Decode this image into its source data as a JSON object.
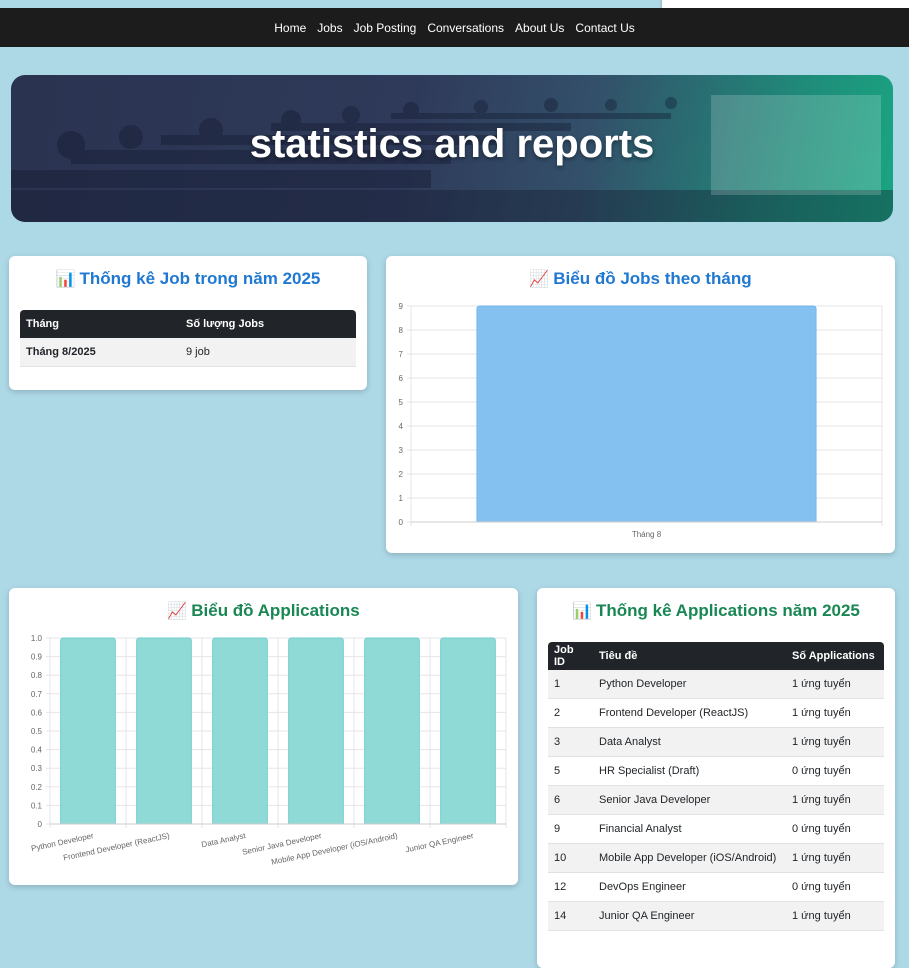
{
  "nav": {
    "items": [
      "Home",
      "Jobs",
      "Job Posting",
      "Conversations",
      "About Us",
      "Contact Us"
    ]
  },
  "hero": {
    "title": "statistics and reports"
  },
  "job_stats": {
    "icon": "bar-chart-emoji",
    "title": "Thống kê Job trong năm 2025",
    "headers": [
      "Tháng",
      "Số lượng Jobs"
    ],
    "rows": [
      {
        "month": "Tháng 8/2025",
        "count": "9 job"
      }
    ]
  },
  "jobs_chart": {
    "icon": "chart-increasing-emoji",
    "title": "Biểu đồ Jobs theo tháng"
  },
  "apps_chart": {
    "icon": "chart-increasing-emoji",
    "title": "Biểu đồ Applications"
  },
  "app_stats": {
    "icon": "bar-chart-emoji",
    "title": "Thống kê Applications năm 2025",
    "headers": [
      "Job ID",
      "Tiêu đề",
      "Số Applications"
    ],
    "rows": [
      {
        "id": "1",
        "title": "Python Developer",
        "apps": "1 ứng tuyển"
      },
      {
        "id": "2",
        "title": "Frontend Developer (ReactJS)",
        "apps": "1 ứng tuyển"
      },
      {
        "id": "3",
        "title": "Data Analyst",
        "apps": "1 ứng tuyển"
      },
      {
        "id": "5",
        "title": "HR Specialist (Draft)",
        "apps": "0 ứng tuyển"
      },
      {
        "id": "6",
        "title": "Senior Java Developer",
        "apps": "1 ứng tuyển"
      },
      {
        "id": "9",
        "title": "Financial Analyst",
        "apps": "0 ứng tuyển"
      },
      {
        "id": "10",
        "title": "Mobile App Developer (iOS/Android)",
        "apps": "1 ứng tuyển"
      },
      {
        "id": "12",
        "title": "DevOps Engineer",
        "apps": "0 ứng tuyển"
      },
      {
        "id": "14",
        "title": "Junior QA Engineer",
        "apps": "1 ứng tuyển"
      }
    ]
  },
  "chart_data": [
    {
      "type": "bar",
      "categories": [
        "Tháng 8"
      ],
      "values": [
        9
      ],
      "ylim": [
        0,
        9
      ],
      "yticks": [
        "0",
        "1",
        "2",
        "3",
        "4",
        "5",
        "6",
        "7",
        "8",
        "9"
      ],
      "grid": true,
      "color": "#85c1f0"
    },
    {
      "type": "bar",
      "categories": [
        "Python Developer",
        "Frontend Developer (ReactJS)",
        "Data Analyst",
        "Senior Java Developer",
        "Mobile App Developer (iOS/Android)",
        "Junior QA Engineer"
      ],
      "values": [
        1,
        1,
        1,
        1,
        1,
        1
      ],
      "ylim": [
        0,
        1.0
      ],
      "yticks": [
        "0",
        "0.1",
        "0.2",
        "0.3",
        "0.4",
        "0.5",
        "0.6",
        "0.7",
        "0.8",
        "0.9",
        "1.0"
      ],
      "grid": true,
      "color": "#8fd9d6"
    }
  ]
}
